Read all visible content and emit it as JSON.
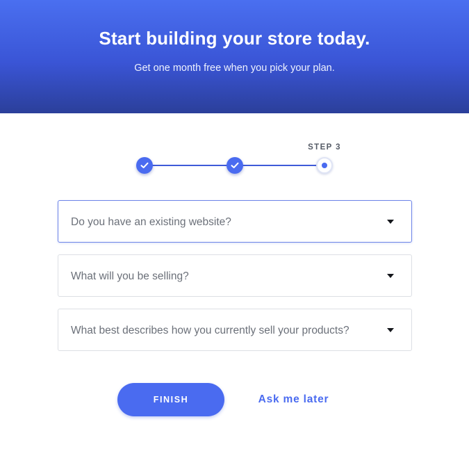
{
  "hero": {
    "title": "Start building your store today.",
    "subtitle": "Get one month free when you pick your plan."
  },
  "stepper": {
    "current_step_label": "STEP 3",
    "steps": [
      {
        "state": "complete",
        "icon": "check-icon"
      },
      {
        "state": "complete",
        "icon": "check-icon"
      },
      {
        "state": "current",
        "icon": "dot-icon"
      }
    ]
  },
  "form": {
    "fields": [
      {
        "placeholder": "Do you have an existing website?",
        "selected": "",
        "icon": "caret-down-icon"
      },
      {
        "placeholder": "What will you be selling?",
        "selected": "",
        "icon": "caret-down-icon"
      },
      {
        "placeholder": "What best describes how you currently sell your products?",
        "selected": "",
        "icon": "caret-down-icon"
      }
    ]
  },
  "actions": {
    "finish_label": "FINISH",
    "later_label": "Ask me later"
  },
  "colors": {
    "accent": "#4a6bf0",
    "hero_top": "#4a6ff0",
    "hero_bottom": "#2b3f9a",
    "label_text": "#6b7079"
  }
}
